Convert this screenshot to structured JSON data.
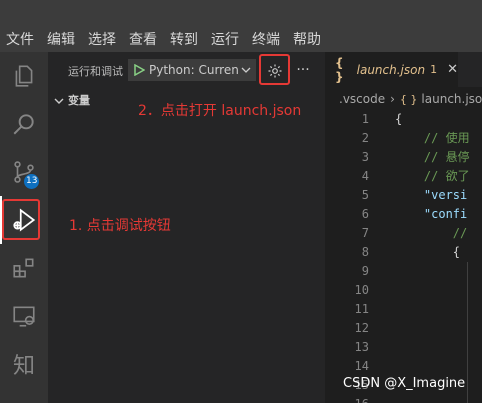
{
  "menubar": {
    "items": [
      "文件",
      "编辑",
      "选择",
      "查看",
      "转到",
      "运行",
      "终端",
      "帮助"
    ]
  },
  "activitybar": {
    "items": [
      {
        "icon": "files-icon"
      },
      {
        "icon": "search-icon"
      },
      {
        "icon": "source-control-icon",
        "badge": "13"
      },
      {
        "icon": "run-debug-icon",
        "active": true
      },
      {
        "icon": "extensions-icon"
      },
      {
        "icon": "remote-explorer-icon"
      },
      {
        "icon": "zhihu-icon",
        "label": "知"
      }
    ]
  },
  "sidebar": {
    "title": "运行和调试",
    "launch_config": "Python: Current File",
    "more": "···",
    "section_label": "变量"
  },
  "editor": {
    "tab": {
      "icon": "{ }",
      "label": "launch.json",
      "dirty": "1",
      "close": "✕"
    },
    "breadcrumb": [
      ".vscode",
      "launch.json"
    ],
    "breadcrumb_icon": "{ }",
    "lines": [
      {
        "num": "1",
        "text": "{",
        "cls": "br"
      },
      {
        "num": "2",
        "text": "    // 使用",
        "cls": "cm"
      },
      {
        "num": "3",
        "text": "    // 悬停",
        "cls": "cm"
      },
      {
        "num": "4",
        "text": "    // 欲了",
        "cls": "cm"
      },
      {
        "num": "5",
        "text": "    \"versi",
        "cls": "key"
      },
      {
        "num": "6",
        "text": "    \"confi",
        "cls": "key"
      },
      {
        "num": "7",
        "text": "        //",
        "cls": "cm"
      },
      {
        "num": "8",
        "text": "        {",
        "cls": "br"
      },
      {
        "num": "9",
        "text": "",
        "cls": "br"
      },
      {
        "num": "10",
        "text": "",
        "cls": "br"
      },
      {
        "num": "11",
        "text": "",
        "cls": "br"
      },
      {
        "num": "12",
        "text": "",
        "cls": "br"
      },
      {
        "num": "13",
        "text": "",
        "cls": "br"
      },
      {
        "num": "14",
        "text": "",
        "cls": "br"
      },
      {
        "num": "15",
        "text": "",
        "cls": "br"
      },
      {
        "num": "16",
        "text": "",
        "cls": "br"
      }
    ]
  },
  "annotations": {
    "step1": "1. 点击调试按钮",
    "step2": "2．点击打开   launch.json",
    "color": "#e53935"
  },
  "watermark": "CSDN @X_Imagine"
}
